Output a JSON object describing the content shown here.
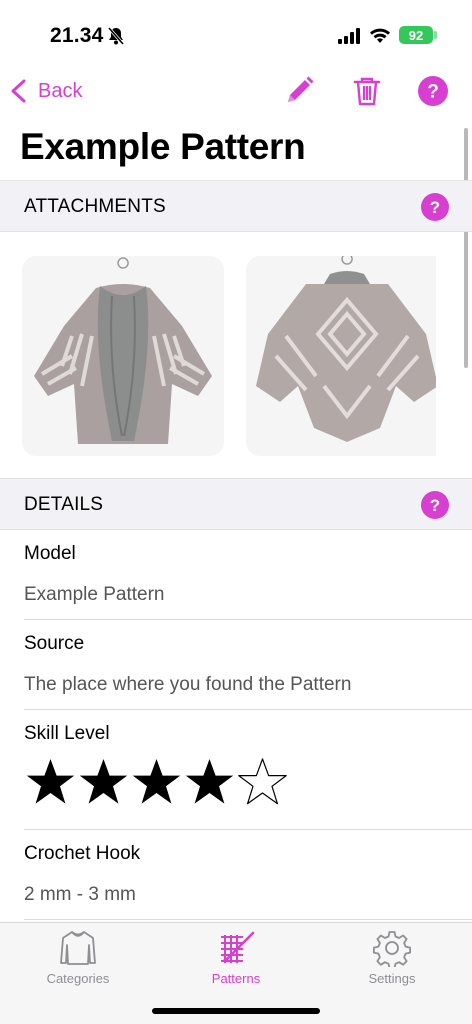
{
  "status_bar": {
    "time": "21.34",
    "battery": "92"
  },
  "nav": {
    "back_label": "Back"
  },
  "page": {
    "title": "Example Pattern"
  },
  "attachments": {
    "header": "ATTACHMENTS",
    "images": [
      "cardigan-front-photo",
      "cardigan-back-photo"
    ]
  },
  "details": {
    "header": "DETAILS",
    "fields": [
      {
        "label": "Model",
        "value": "Example Pattern"
      },
      {
        "label": "Source",
        "value": "The place where you found the Pattern"
      },
      {
        "label": "Skill Level",
        "rating": 4,
        "max": 5
      },
      {
        "label": "Crochet Hook",
        "value": "2 mm - 3 mm"
      }
    ]
  },
  "tabs": [
    {
      "label": "Categories",
      "icon": "sweater-icon",
      "active": false
    },
    {
      "label": "Patterns",
      "icon": "yarn-needle-icon",
      "active": true
    },
    {
      "label": "Settings",
      "icon": "gear-icon",
      "active": false
    }
  ],
  "colors": {
    "accent": "#d63fcf",
    "section_bg": "#f2f2f6",
    "battery": "#34c759"
  }
}
